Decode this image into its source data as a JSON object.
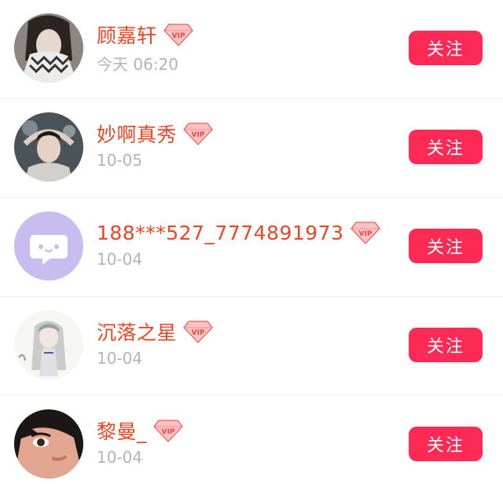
{
  "follow_label": "关注",
  "colors": {
    "name": "#ee4424",
    "button": "#fd2a56",
    "date": "#b3b3b3"
  },
  "users": [
    {
      "name": "顾嘉轩",
      "date": "今天 06:20",
      "vip_badge": "VIP"
    },
    {
      "name": "妙啊真秀",
      "date": "10-05",
      "vip_badge": "VIP"
    },
    {
      "name": "188***527_7774891973",
      "date": "10-04",
      "vip_badge": "VIP"
    },
    {
      "name": "沉落之星",
      "date": "10-04",
      "vip_badge": "VIP"
    },
    {
      "name": "黎曼_",
      "date": "10-04",
      "vip_badge": "VIP"
    }
  ]
}
